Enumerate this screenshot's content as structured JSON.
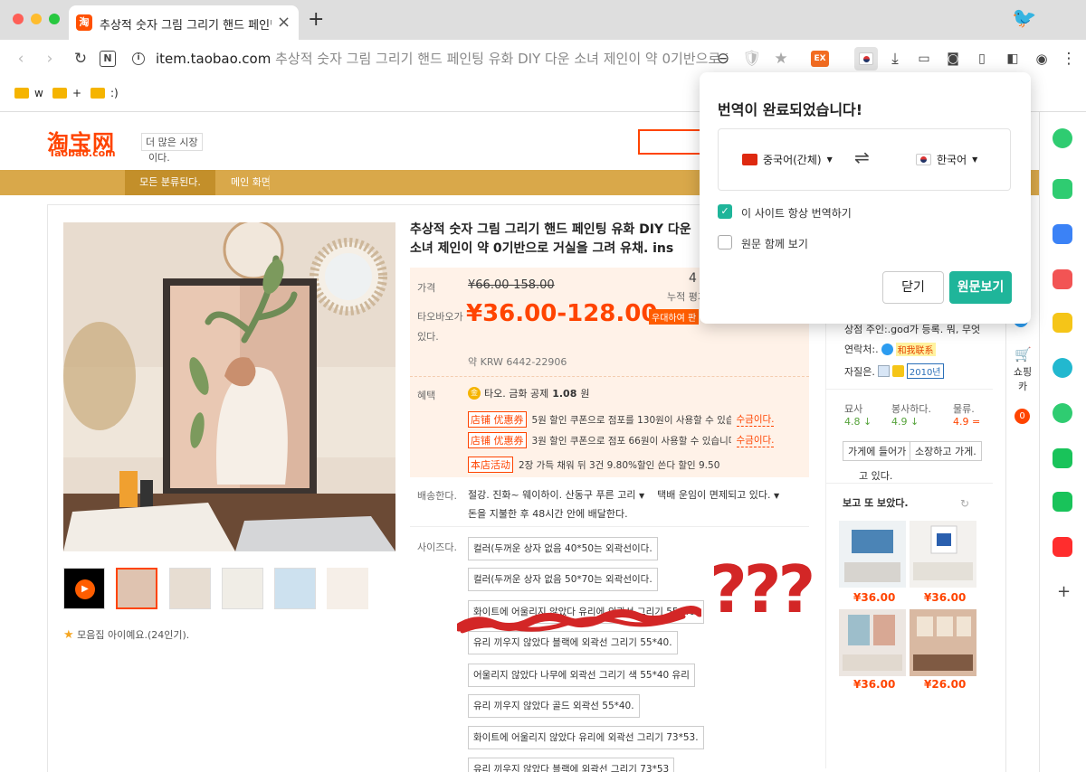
{
  "browser": {
    "tab_title": "추상적 숫자 그림 그리기 핸드 페인팅",
    "tab_favicon": "淘",
    "url_host": "item.taobao.com",
    "url_rest": "추상적 숫자 그림 그리기 핸드 페인팅 유화 DIY 다운 소녀 제인이 약 0기반으로 거",
    "bookmarks": [
      "w",
      "+",
      ":)"
    ],
    "ext_badge": "EX"
  },
  "taobao": {
    "logo_cn": "淘宝网",
    "logo_en": "Taobao.com",
    "more_market": "더 많은 시장",
    "market_sub": "이다.",
    "nav_all": "모든 분류된다.",
    "nav_home": "메인 화면"
  },
  "product": {
    "title": "추상적 숫자 그림 그리기 핸드 페인팅 유화 DIY 다운 소녀 제인이 약 0기반으로 거실을 그려 유채. ins",
    "price_label": "가격",
    "original_price": "¥66.00-158.00",
    "taobao_price_label": "타오바오가",
    "taobao_price_sub": "있다.",
    "sale_price": "¥36.00-128.00",
    "promo_tag": "우대하여 판",
    "krw": "약 KRW 6442-22906",
    "sales_num": "4",
    "review_label": "누적 평가",
    "benefit_label": "혜택",
    "benefit_text": "타오. 금화 공제",
    "benefit_value": "1.08",
    "benefit_unit": "원",
    "coupons": [
      {
        "tag": "店铺 优惠券",
        "text": "5원 할인 쿠폰으로 점포를 130원이 사용할 수 있습니다. 사용할 수 있습니다.",
        "claim": "수금이다."
      },
      {
        "tag": "店铺 优惠券",
        "text": "3원 할인 쿠폰으로 점포 66원이 사용할 수 있습니다. 사용할 수 있습니다.",
        "claim": "수금이다."
      }
    ],
    "store_event_tag": "本店活动",
    "store_event_text": "2장 가득 채워 뒤 3건 9.80%할인 쓴다 할인 9.50",
    "shipping_label": "배송한다.",
    "shipping_from": "절강. 진화~ 웨이하이. 산동구 푸른 고리",
    "shipping_fee": "택배 운임이 면제되고 있다.",
    "shipping_time": "돈을 지불한 후 48시간 안에 배달한다.",
    "size_label": "사이즈다.",
    "options": [
      "컬러(두꺼운 상자 없음 40*50는 외곽선이다.",
      "컬러(두꺼운 상자 없음 50*70는 외곽선이다.",
      "화이트에 어울리지 않았다 유리에 외곽선 그리기 55*40.",
      "유리 끼우지 않았다 블랙에 외곽선 그리기 55*40.",
      "어울리지 않았다 나무에 외곽선 그리기 색 55*40 유리",
      "유리 끼우지 않았다 골드 외곽선 55*40.",
      "화이트에 어울리지 않았다 유리에 외곽선 그리기 73*53.",
      "유리 끼우지 않았다 블랙에 외곽선 그리기 73*53"
    ],
    "favorites": "모음집 아이예요.(24인기)."
  },
  "shop": {
    "owner": "상점 주인:.god가 등록. 뭐, 무엇",
    "contact_label": "연락처:.",
    "contact_tag": "和我联系",
    "qualification_label": "자질은.",
    "qualification_year": "2010년",
    "scores": [
      {
        "label": "묘사",
        "value": "4.8"
      },
      {
        "label": "봉사하다.",
        "value": "4.9"
      },
      {
        "label": "물류.",
        "value": "4.9"
      }
    ],
    "enter_store": "가게에 들어가",
    "enter_store_sub": "고 있다.",
    "save_store": "소장하고 가게.",
    "seen_title": "보고 또 보았다.",
    "recs": [
      "¥36.00",
      "¥36.00",
      "¥36.00",
      "¥26.00"
    ],
    "cart_label": "쇼핑카",
    "cart_count": "0"
  },
  "translate_popup": {
    "title": "번역이 완료되었습니다!",
    "source_lang": "중국어(간체)",
    "target_lang": "한국어",
    "always_translate": "이 사이트 항상 번역하기",
    "always_checked": true,
    "show_original": "원문 함께 보기",
    "show_checked": false,
    "close": "닫기",
    "view_original": "원문보기"
  },
  "annotation": {
    "marks": "???"
  },
  "colors": {
    "taobao_orange": "#ff4400",
    "nav_gold": "#d9a84a",
    "accent_green": "#1fb59a",
    "annotation_red": "#d32626"
  }
}
